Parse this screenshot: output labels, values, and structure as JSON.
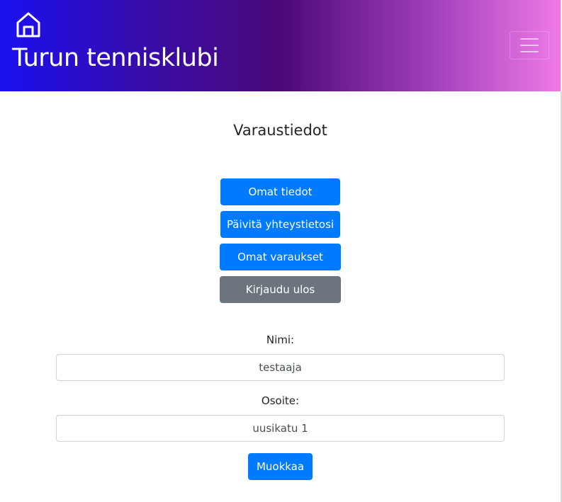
{
  "header": {
    "brand": "Turun tennisklubi",
    "home_icon": "home-icon",
    "menu_icon": "hamburger-menu-icon",
    "gradient": [
      "#1a10f0",
      "#4a0878",
      "#ee7ae6"
    ]
  },
  "page": {
    "title": "Varaustiedot"
  },
  "actions": {
    "own_info": "Omat tiedot",
    "update_contact": "Päivitä yhteystietosi",
    "own_bookings": "Omat varaukset",
    "logout": "Kirjaudu ulos"
  },
  "form": {
    "name_label": "Nimi:",
    "name_value": "testaaja",
    "address_label": "Osoite:",
    "address_value": "uusikatu 1",
    "edit_button": "Muokkaa"
  },
  "colors": {
    "primary": "#007bff",
    "secondary": "#6c757d"
  }
}
